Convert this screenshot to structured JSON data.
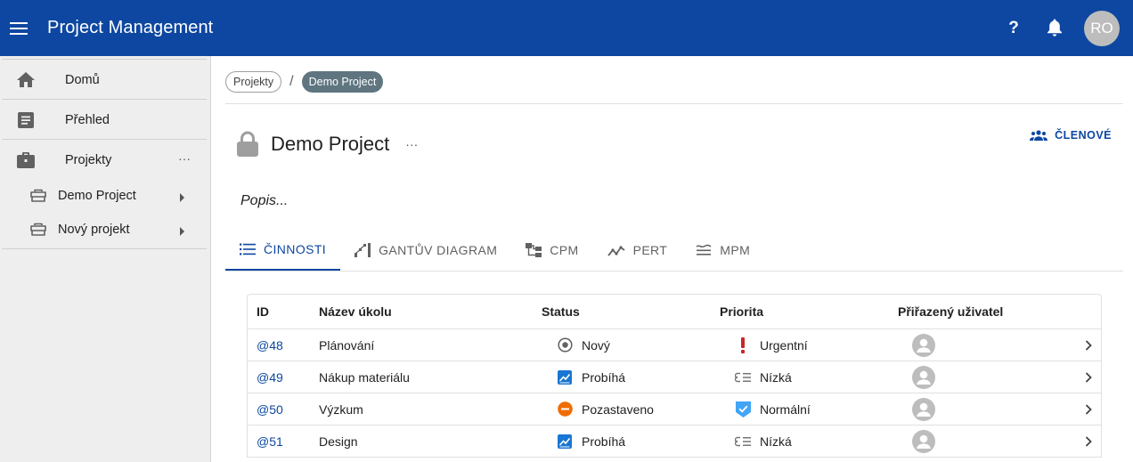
{
  "app": {
    "title": "Project Management",
    "help_label": "?",
    "avatar_initials": "RO",
    "primary_color": "#0d47a1"
  },
  "sidebar": {
    "items": [
      {
        "label": "Domů",
        "icon": "home-icon"
      },
      {
        "label": "Přehled",
        "icon": "article-icon"
      },
      {
        "label": "Projekty",
        "icon": "briefcase-icon",
        "more": "···"
      }
    ],
    "projects": [
      {
        "label": "Demo Project",
        "icon": "project-icon"
      },
      {
        "label": "Nový projekt",
        "icon": "project-icon"
      }
    ]
  },
  "breadcrumb": {
    "root": "Projekty",
    "separator": "/",
    "current": "Demo Project"
  },
  "project": {
    "title": "Demo Project",
    "more": "···",
    "members_label": "ČLENOVÉ",
    "description_placeholder": "Popis..."
  },
  "tabs": [
    {
      "label": "ČINNOSTI",
      "icon": "list-icon",
      "active": true
    },
    {
      "label": "GANTŮV DIAGRAM",
      "icon": "gantt-icon",
      "active": false
    },
    {
      "label": "CPM",
      "icon": "cpm-icon",
      "active": false
    },
    {
      "label": "PERT",
      "icon": "pert-icon",
      "active": false
    },
    {
      "label": "MPM",
      "icon": "mpm-icon",
      "active": false
    }
  ],
  "table": {
    "columns": [
      "ID",
      "Název úkolu",
      "Status",
      "Priorita",
      "Přiřazený uživatel"
    ],
    "rows": [
      {
        "id": "@48",
        "name": "Plánování",
        "status": "Nový",
        "status_icon": "new-status-icon",
        "priority": "Urgentní",
        "priority_icon": "urgent-icon"
      },
      {
        "id": "@49",
        "name": "Nákup materiálu",
        "status": "Probíhá",
        "status_icon": "in-progress-icon",
        "priority": "Nízká",
        "priority_icon": "low-priority-icon"
      },
      {
        "id": "@50",
        "name": "Výzkum",
        "status": "Pozastaveno",
        "status_icon": "paused-icon",
        "priority": "Normální",
        "priority_icon": "normal-priority-icon"
      },
      {
        "id": "@51",
        "name": "Design",
        "status": "Probíhá",
        "status_icon": "in-progress-icon",
        "priority": "Nízká",
        "priority_icon": "low-priority-icon"
      }
    ]
  },
  "colors": {
    "in_progress": "#1976d2",
    "paused": "#ef6c00",
    "urgent": "#c62828",
    "normal": "#42a5f5"
  }
}
